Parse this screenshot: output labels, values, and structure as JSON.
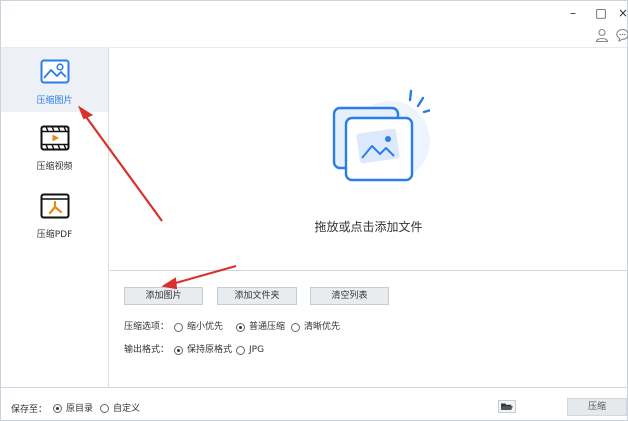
{
  "window": {
    "minimize_glyph": "–",
    "maximize_glyph": "□",
    "close_glyph": "×",
    "icons": [
      "user-icon",
      "chat-icon"
    ]
  },
  "sidebar": {
    "items": [
      {
        "label": "压缩图片",
        "icon": "image-icon",
        "active": true
      },
      {
        "label": "压缩视频",
        "icon": "video-icon",
        "active": false
      },
      {
        "label": "压缩PDF",
        "icon": "pdf-icon",
        "active": false
      }
    ]
  },
  "dropzone": {
    "text": "拖放或点击添加文件",
    "icon": "add-image-illustration"
  },
  "toolbar": {
    "add_image": "添加图片",
    "add_folder": "添加文件夹",
    "clear_list": "清空列表"
  },
  "options": {
    "compress_label": "压缩选项：",
    "compress_options": [
      {
        "label": "缩小优先",
        "selected": false
      },
      {
        "label": "普通压缩",
        "selected": true
      },
      {
        "label": "清晰优先",
        "selected": false
      }
    ],
    "format_label": "输出格式：",
    "format_options": [
      {
        "label": "保持原格式",
        "selected": true
      },
      {
        "label": "JPG",
        "selected": false
      }
    ]
  },
  "footer": {
    "save_label": "保存至：",
    "save_options": [
      {
        "label": "原目录",
        "selected": true
      },
      {
        "label": "自定义",
        "selected": false
      }
    ],
    "folder_icon": "folder-open-icon",
    "compress_button": "压缩"
  },
  "colors": {
    "accent": "#2b7de9",
    "sidebar_active": "#edf1f6",
    "annotation_arrow": "#d9322b"
  }
}
